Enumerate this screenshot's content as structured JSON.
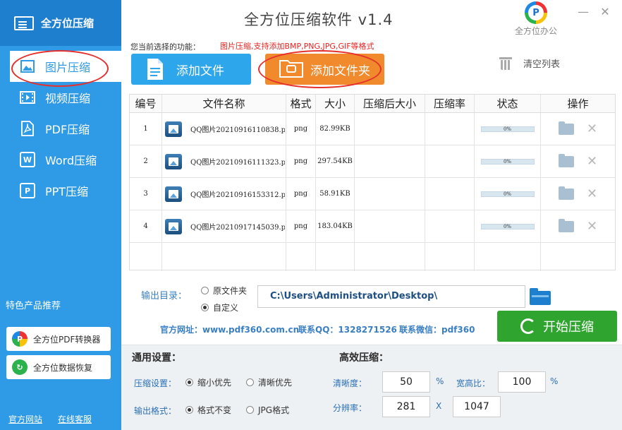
{
  "app": {
    "title": "全方位压缩软件 v1.4",
    "logo_text": "全方位压缩",
    "brand_text": "全方位办公",
    "brand_logo_letter": "P",
    "minimize_symbol": "—",
    "close_symbol": "✕"
  },
  "sidebar": {
    "items": [
      {
        "label": "图片压缩",
        "icon": "image-icon",
        "active": true
      },
      {
        "label": "视频压缩",
        "icon": "film-icon",
        "active": false
      },
      {
        "label": "PDF压缩",
        "icon": "pdf-icon",
        "active": false
      },
      {
        "label": "Word压缩",
        "icon": "word-icon",
        "active": false
      },
      {
        "label": "PPT压缩",
        "icon": "ppt-icon",
        "active": false
      }
    ],
    "promo_title": "特色产品推荐",
    "promo_buttons": [
      {
        "label": "全方位PDF转换器",
        "icon": "pdf-converter-icon"
      },
      {
        "label": "全方位数据恢复",
        "icon": "data-recovery-icon"
      }
    ],
    "footer_links": [
      "官方网站",
      "在线客服"
    ]
  },
  "toolbar": {
    "function_label": "您当前选择的功能：",
    "function_value": "图片压缩,支持添加BMP,PNG,JPG,GIF等格式",
    "add_file": "添加文件",
    "add_folder": "添加文件夹",
    "clear_list": "清空列表"
  },
  "table": {
    "headers": [
      "编号",
      "文件名称",
      "格式",
      "大小",
      "压缩后大小",
      "压缩率",
      "状态",
      "操作"
    ],
    "rows": [
      {
        "no": "1",
        "name": "QQ图片20210916110838.png",
        "format": "png",
        "size": "82.99KB",
        "compressed": "",
        "ratio": "",
        "progress": "0%",
        "progress_value": 0
      },
      {
        "no": "2",
        "name": "QQ图片20210916111323.png",
        "format": "png",
        "size": "297.54KB",
        "compressed": "",
        "ratio": "",
        "progress": "0%",
        "progress_value": 0
      },
      {
        "no": "3",
        "name": "QQ图片20210916153312.png",
        "format": "png",
        "size": "58.91KB",
        "compressed": "",
        "ratio": "",
        "progress": "0%",
        "progress_value": 0
      },
      {
        "no": "4",
        "name": "QQ图片20210917145039.png",
        "format": "png",
        "size": "183.04KB",
        "compressed": "",
        "ratio": "",
        "progress": "0%",
        "progress_value": 0
      }
    ]
  },
  "output": {
    "label": "输出目录：",
    "option_original": "原文件夹",
    "option_custom": "自定义",
    "selected": "custom",
    "path": "C:\\Users\\Administrator\\Desktop\\"
  },
  "info": {
    "website": "官方网址：www.pdf360.com.cn",
    "qq": "联系QQ：1328271526",
    "wechat": "联系微信：pdf360"
  },
  "start_button": "开始压缩",
  "settings": {
    "general_title": "通用设置：",
    "compress_label": "压缩设置：",
    "compress_options": [
      "缩小优先",
      "清晰优先"
    ],
    "compress_selected": 0,
    "format_label": "输出格式：",
    "format_options": [
      "格式不变",
      "JPG格式"
    ],
    "format_selected": 0,
    "advanced_title": "高效压缩：",
    "clarity_label": "清晰度：",
    "clarity_value": "50",
    "clarity_unit": "%",
    "aspect_label": "宽高比：",
    "aspect_value": "100",
    "aspect_unit": "%",
    "resolution_label": "分辨率：",
    "res_width": "281",
    "res_sep": "X",
    "res_height": "1047"
  },
  "colors": {
    "sidebar": "#2f9ae6",
    "add_file_button": "#2ea6ec",
    "add_folder_button": "#f08a2c",
    "start_button": "#2fa52f",
    "highlight_oval": "#e5302e"
  }
}
